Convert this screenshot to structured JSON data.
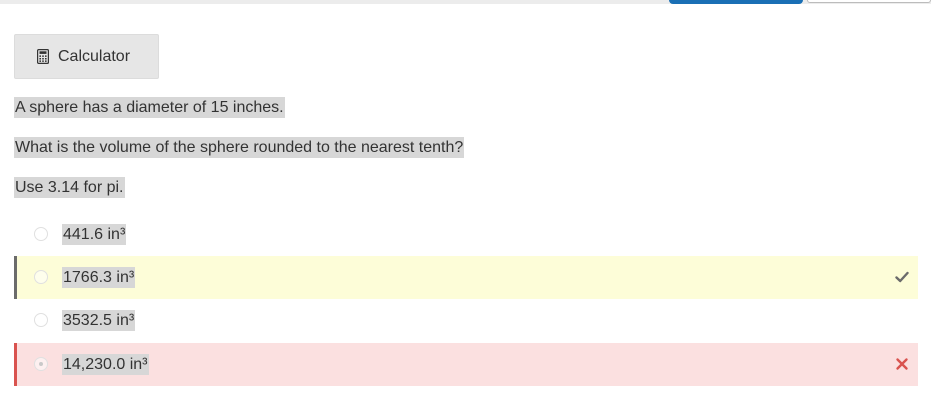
{
  "calculator": {
    "label": "Calculator",
    "icon": "calculator-icon"
  },
  "question": {
    "line1": "A sphere has a diameter of 15 inches.",
    "line2": "What is the volume of the sphere rounded to the nearest tenth?",
    "line3": "Use 3.14 for pi."
  },
  "choices": [
    {
      "label": "441.6 in³",
      "state": "none",
      "selected": false
    },
    {
      "label": "1766.3 in³",
      "state": "correct",
      "selected": false,
      "icon": "checkmark-icon"
    },
    {
      "label": "3532.5 in³",
      "state": "none",
      "selected": false
    },
    {
      "label": "14,230.0 in³",
      "state": "incorrect",
      "selected": true,
      "icon": "x-mark-icon"
    }
  ],
  "colors": {
    "accent": "#1a6fb5",
    "correct_bg": "#fdfdd8",
    "incorrect_bg": "#fbe0e0",
    "incorrect_mark": "#d9534f",
    "text_highlight": "#d7d7d7"
  }
}
